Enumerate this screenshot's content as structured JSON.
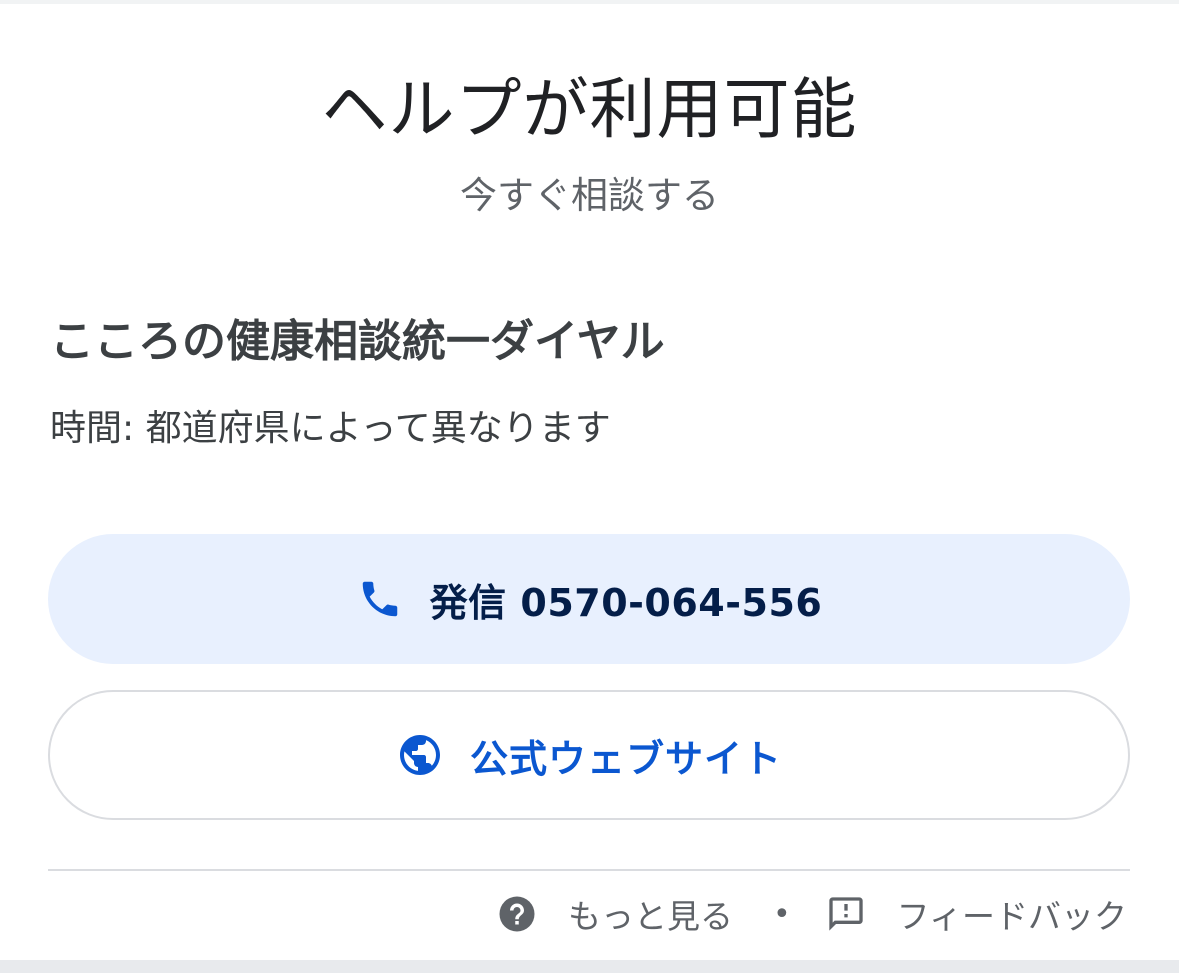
{
  "header": {
    "title": "ヘルプが利用可能",
    "subtitle": "今すぐ相談する"
  },
  "service": {
    "name": "こころの健康相談統一ダイヤル",
    "hours_label": "時間:",
    "hours_value": "都道府県によって異なります"
  },
  "actions": {
    "call_label": "発信 0570-064-556",
    "call_icon": "phone-icon",
    "website_label": "公式ウェブサイト",
    "website_icon": "globe-icon"
  },
  "footer": {
    "more_label": "もっと見る",
    "more_icon": "help-circle-icon",
    "separator": "•",
    "feedback_label": "フィードバック",
    "feedback_icon": "feedback-icon"
  },
  "colors": {
    "call_bg": "#e8f0fe",
    "accent_blue": "#0b57d0",
    "text_dark": "#202124",
    "text_muted": "#5f6368"
  }
}
